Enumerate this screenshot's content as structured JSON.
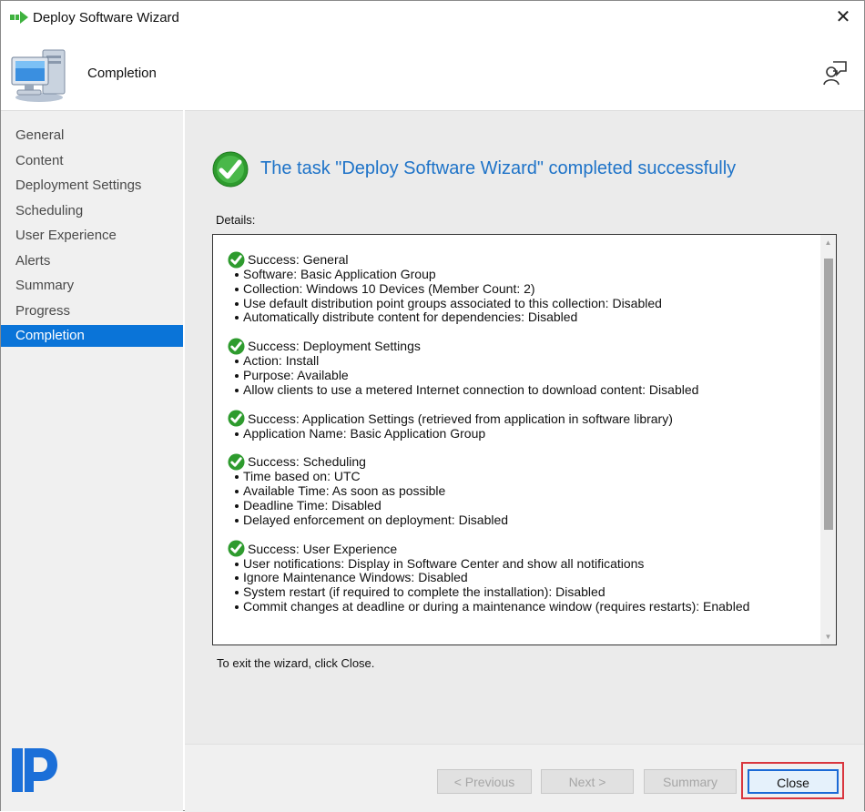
{
  "window": {
    "title": "Deploy Software Wizard",
    "close_glyph": "✕"
  },
  "header": {
    "title": "Completion",
    "icons": [
      "computer-icon",
      "feedback-icon"
    ]
  },
  "sidebar": {
    "items": [
      {
        "label": "General"
      },
      {
        "label": "Content"
      },
      {
        "label": "Deployment Settings"
      },
      {
        "label": "Scheduling"
      },
      {
        "label": "User Experience"
      },
      {
        "label": "Alerts"
      },
      {
        "label": "Summary"
      },
      {
        "label": "Progress"
      },
      {
        "label": "Completion",
        "active": true
      }
    ],
    "active_color": "#0a74d8"
  },
  "main": {
    "heading": "The task \"Deploy Software Wizard\" completed successfully",
    "heading_color": "#1e73c8",
    "details_label": "Details:",
    "sections": [
      {
        "title": "Success: General",
        "items": [
          "Software: Basic Application Group",
          "Collection: Windows 10 Devices (Member Count: 2)",
          "Use default distribution point groups associated to this collection: Disabled",
          "Automatically distribute content for dependencies: Disabled"
        ]
      },
      {
        "title": "Success: Deployment Settings",
        "items": [
          "Action: Install",
          "Purpose: Available",
          "Allow clients to use a metered Internet connection to download content: Disabled"
        ]
      },
      {
        "title": "Success: Application Settings (retrieved from application in software library)",
        "items": [
          "Application Name: Basic Application Group"
        ]
      },
      {
        "title": "Success: Scheduling",
        "items": [
          "Time based on: UTC",
          "Available Time: As soon as possible",
          "Deadline Time: Disabled",
          "Delayed enforcement on deployment: Disabled"
        ]
      },
      {
        "title": "Success: User Experience",
        "items": [
          "User notifications: Display in Software Center and show all notifications",
          "Ignore Maintenance Windows: Disabled",
          "System restart  (if required to complete the installation): Disabled",
          "Commit changes at deadline or during a maintenance window (requires restarts): Enabled"
        ]
      }
    ],
    "exit_text": "To exit the wizard, click Close."
  },
  "footer": {
    "previous_label": "< Previous",
    "next_label": "Next >",
    "summary_label": "Summary",
    "close_label": "Close",
    "highlight_color": "#d9363e"
  }
}
